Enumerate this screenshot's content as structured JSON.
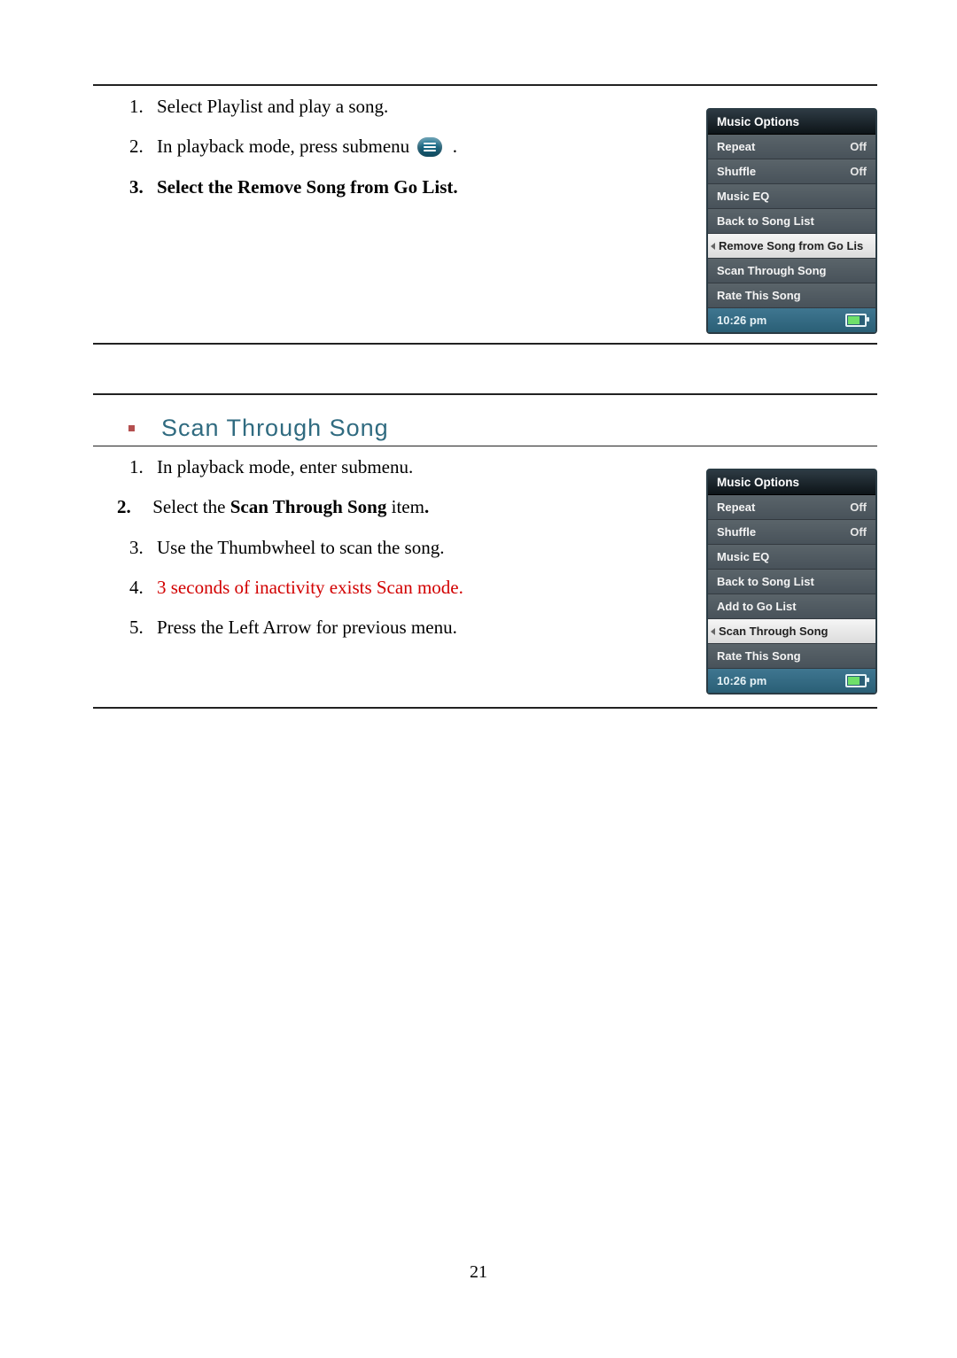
{
  "section1": {
    "steps": [
      {
        "html": "Select Playlist and play a song."
      },
      {
        "html": "In playback mode, press submenu {icon} ."
      },
      {
        "html": "<b>Select the </b><b>Remove Song from Go List.</b>",
        "bold_marker": true
      }
    ],
    "device": {
      "title": "Music Options",
      "items": [
        {
          "label": "Repeat",
          "value": "Off"
        },
        {
          "label": "Shuffle",
          "value": "Off"
        },
        {
          "label": "Music EQ"
        },
        {
          "label": "Back to Song List"
        },
        {
          "label": "Remove Song from Go Lis",
          "selected": true
        },
        {
          "label": "Scan Through Song"
        },
        {
          "label": "Rate This Song"
        }
      ],
      "status_time": "10:26 pm"
    }
  },
  "section2": {
    "heading": "Scan Through Song",
    "steps": [
      {
        "text": "In playback mode, enter submenu."
      },
      {
        "prefix_bold": "2.",
        "select_prefix": "Select the ",
        "bold_item": "Scan Through Song",
        "suffix": " item",
        "trailing_period_bold": true
      },
      {
        "text": "Use the Thumbwheel to scan the song."
      },
      {
        "text": "3 seconds of inactivity exists Scan mode.",
        "red": true
      },
      {
        "text": "Press the Left Arrow for previous menu."
      }
    ],
    "device": {
      "title": "Music Options",
      "items": [
        {
          "label": "Repeat",
          "value": "Off"
        },
        {
          "label": "Shuffle",
          "value": "Off"
        },
        {
          "label": "Music EQ"
        },
        {
          "label": "Back to Song List"
        },
        {
          "label": "Add to Go List"
        },
        {
          "label": "Scan Through Song",
          "selected": true
        },
        {
          "label": "Rate This Song"
        }
      ],
      "status_time": "10:26 pm"
    }
  },
  "page_number": "21"
}
